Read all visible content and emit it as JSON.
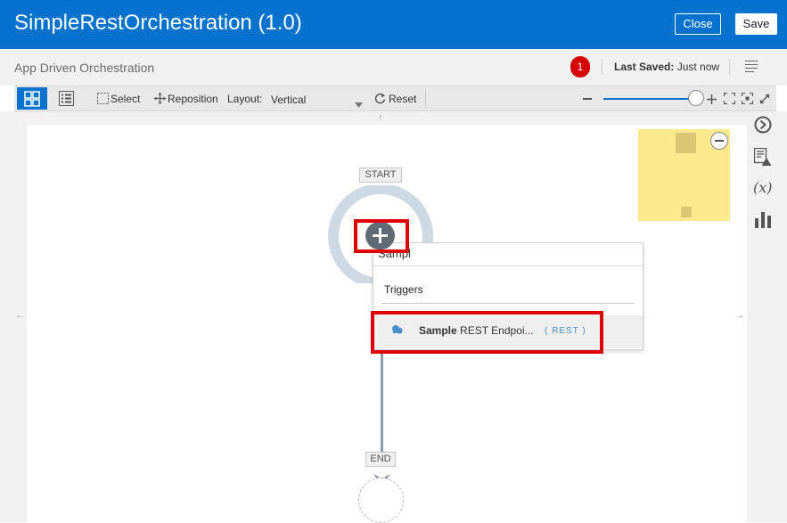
{
  "header": {
    "title": "SimpleRestOrchestration (1.0)",
    "close_label": "Close",
    "save_label": "Save"
  },
  "subheader": {
    "title": "App Driven Orchestration",
    "error_count": "1",
    "last_saved_label": "Last Saved:",
    "last_saved_value": "Just now"
  },
  "toolbar": {
    "select_label": "Select",
    "reposition_label": "Reposition",
    "layout_label": "Layout:",
    "layout_value": "Vertical",
    "reset_label": "Reset"
  },
  "canvas": {
    "start_label": "START",
    "end_label": "END"
  },
  "popup": {
    "search_value": "Sampl",
    "section_label": "Triggers",
    "item_match": "Sample",
    "item_rest": " REST Endpoi...",
    "item_tag": "( REST )"
  },
  "colors": {
    "brand": "#0572ce",
    "error": "#d60000",
    "highlight": "#e00000",
    "minimap": "#fdea8e"
  },
  "icons": [
    "puzzle-icon",
    "list-icon",
    "select-icon",
    "reposition-icon",
    "reset-icon",
    "zoom-out-icon",
    "zoom-in-icon",
    "fit-icon",
    "hamburger-icon",
    "arrow-circle-icon",
    "warning-doc-icon",
    "variable-icon",
    "bar-chart-icon",
    "plus-icon",
    "cloud-icon"
  ]
}
